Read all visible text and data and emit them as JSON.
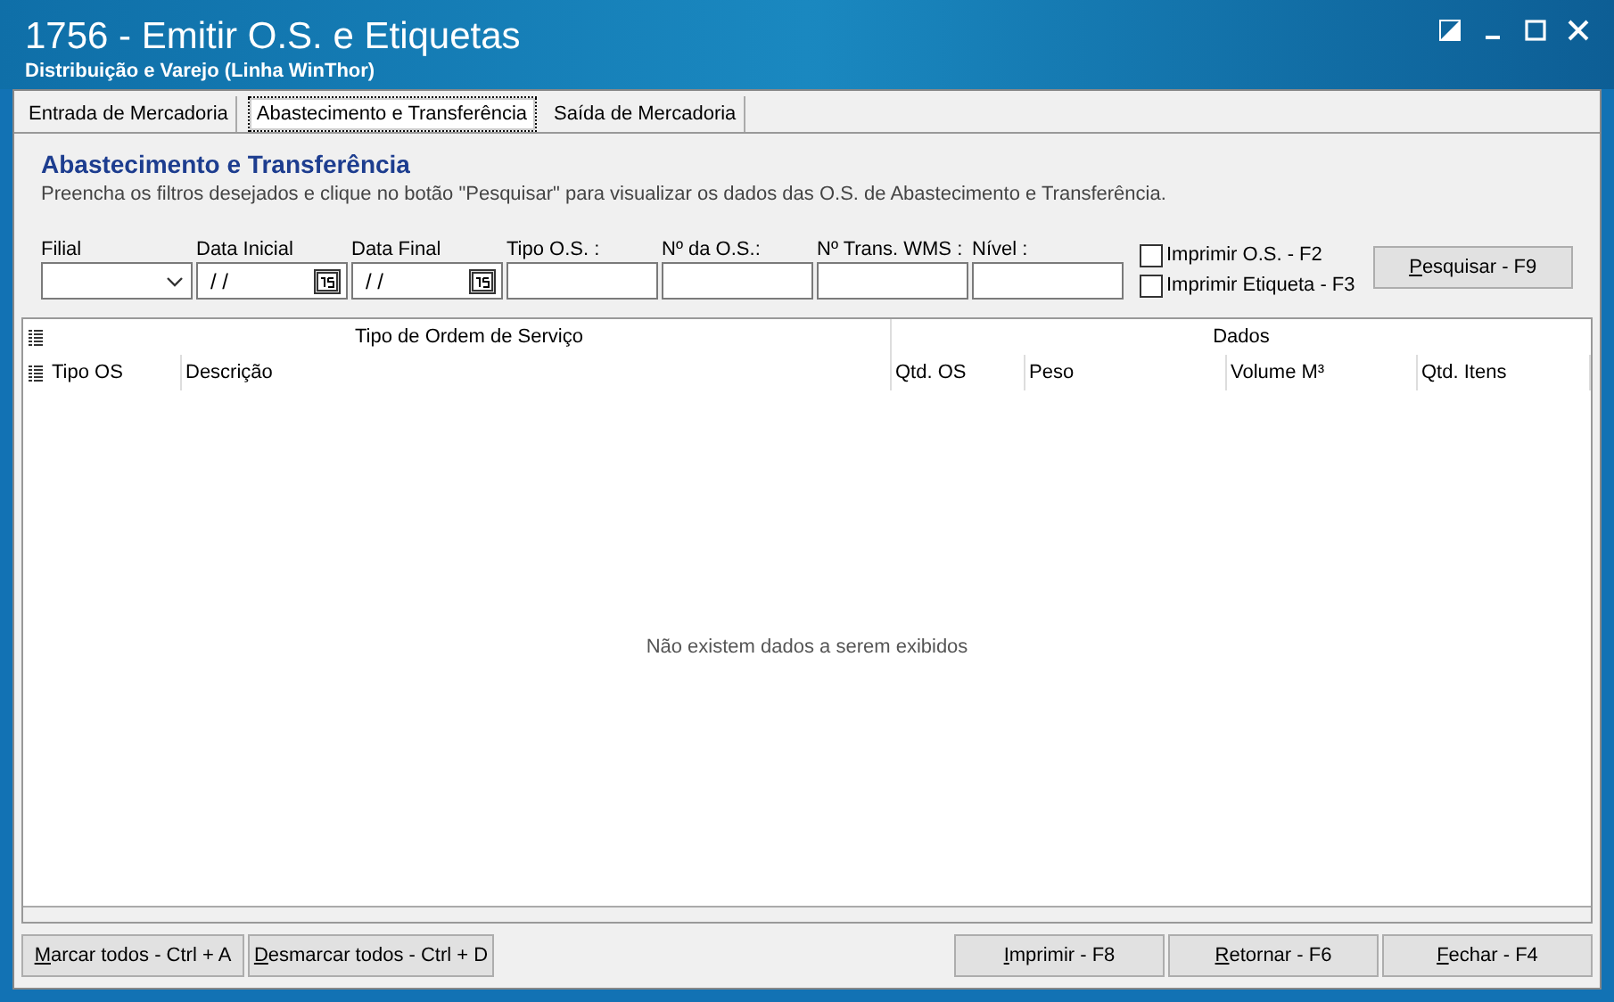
{
  "window": {
    "title": "1756 - Emitir O.S. e Etiquetas",
    "subtitle": "Distribuição e Varejo (Linha WinThor)"
  },
  "tabs": [
    {
      "label": "Entrada de Mercadoria",
      "selected": false
    },
    {
      "label": "Abastecimento e Transferência",
      "selected": true
    },
    {
      "label": "Saída de Mercadoria",
      "selected": false
    }
  ],
  "section": {
    "title": "Abastecimento e Transferência",
    "description": "Preencha os filtros desejados e clique no botão \"Pesquisar\" para visualizar os dados das O.S. de Abastecimento e Transferência."
  },
  "filters": [
    {
      "label": "Filial",
      "kind": "select"
    },
    {
      "label": "Data Inicial",
      "kind": "date",
      "value": "/ /"
    },
    {
      "label": "Data Final",
      "kind": "date",
      "value": "/ /"
    },
    {
      "label": "Tipo O.S. :",
      "kind": "text"
    },
    {
      "label": "Nº da O.S.:",
      "kind": "text"
    },
    {
      "label": "Nº Trans. WMS :",
      "kind": "text"
    },
    {
      "label": "Nível :",
      "kind": "text"
    }
  ],
  "checkboxes": [
    {
      "label": "Imprimir O.S. - F2",
      "checked": false
    },
    {
      "label": "Imprimir Etiqueta - F3",
      "checked": false
    }
  ],
  "search_button": "Pesquisar - F9",
  "table": {
    "groups": [
      "Tipo de Ordem de Serviço",
      "Dados"
    ],
    "columns": [
      "Tipo OS",
      "Descrição",
      "Qtd. OS",
      "Peso",
      "Volume M³",
      "Qtd. Itens"
    ],
    "empty_message": "Não existem dados a serem exibidos"
  },
  "left_buttons": [
    "Marcar todos - Ctrl + A",
    "Desmarcar todos - Ctrl + D"
  ],
  "right_buttons": [
    "Imprimir - F8",
    "Retornar - F6",
    "Fechar - F4"
  ]
}
